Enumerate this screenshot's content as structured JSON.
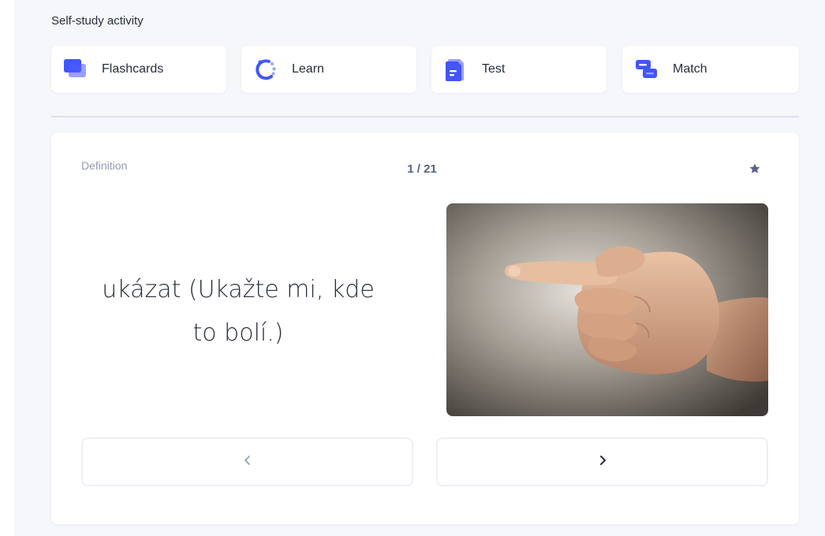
{
  "section": {
    "title": "Self-study activity"
  },
  "modes": [
    {
      "label": "Flashcards",
      "icon": "flashcards-icon"
    },
    {
      "label": "Learn",
      "icon": "learn-icon"
    },
    {
      "label": "Test",
      "icon": "test-icon"
    },
    {
      "label": "Match",
      "icon": "match-icon"
    }
  ],
  "card": {
    "side_label": "Definition",
    "counter": "1 / 21",
    "term_line1": "ukázat (Ukažte mi, kde",
    "term_line2": "to bolí.)",
    "image_icon": "pointing-hand-photo",
    "star_icon": "star-icon",
    "prev_icon": "chevron-left-icon",
    "next_icon": "chevron-right-icon"
  },
  "colors": {
    "accent": "#4255ff",
    "accent_light": "#98a0ff",
    "text_primary": "#282e3e",
    "text_secondary": "#939bb4",
    "page_background": "#f6f7fb"
  }
}
